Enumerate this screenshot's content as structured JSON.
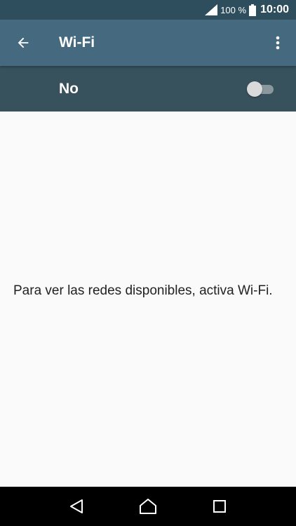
{
  "status_bar": {
    "battery_percent": "100 %",
    "time": "10:00",
    "icons": [
      "signal-icon",
      "battery-icon"
    ]
  },
  "app_bar": {
    "title": "Wi-Fi",
    "icons": [
      "arrow-back-icon",
      "more-vert-icon"
    ]
  },
  "wifi_switch": {
    "label": "No",
    "state": "off"
  },
  "content": {
    "message": "Para ver las redes disponibles, activa Wi-Fi."
  },
  "nav_bar": {
    "icons": [
      "back-triangle-icon",
      "home-icon",
      "recents-icon"
    ]
  },
  "colors": {
    "status_bar": "#2f4e5d",
    "app_bar": "#456a7f",
    "switch_bar": "#37515d",
    "background": "#fafafa"
  }
}
